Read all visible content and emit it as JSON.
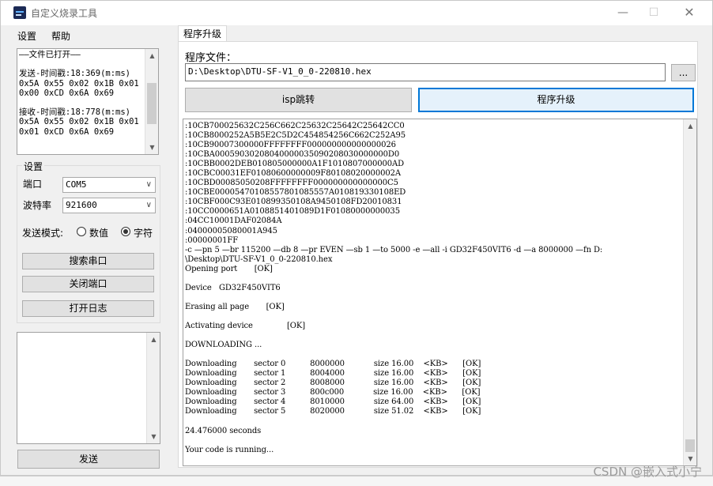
{
  "window": {
    "title": "自定义烧录工具",
    "controls": {
      "minimize": "—",
      "maximize": "☐",
      "close": "✕"
    }
  },
  "menu": {
    "items": [
      "设置",
      "帮助"
    ]
  },
  "log": {
    "lines": [
      "——文件已打开——",
      "",
      "发送-时间戳:18:369(m:ms)",
      "0x5A 0x55 0x02 0x1B 0x01",
      "0x00 0xCD 0x6A 0x69",
      "",
      "接收-时间戳:18:778(m:ms)",
      "0x5A 0x55 0x02 0x1B 0x01",
      "0x01 0xCD 0x6A 0x69"
    ],
    "scroll_position": 0.55
  },
  "settings": {
    "legend": "设置",
    "port_label": "端口",
    "port_value": "COM5",
    "baud_label": "波特率",
    "baud_value": "921600",
    "mode_label": "发送模式:",
    "mode_options": [
      "数值",
      "字符"
    ],
    "mode_selected": "字符",
    "btn_search": "搜索串口",
    "btn_close_port": "关闭端口",
    "btn_open_log": "打开日志"
  },
  "send_button": "发送",
  "tab": {
    "label": "程序升级"
  },
  "program": {
    "file_label": "程序文件：",
    "file_path": "D:\\Desktop\\DTU-SF-V1_0_0-220810.hex",
    "browse_label": "...",
    "isp_button": "isp跳转",
    "upgrade_button": "程序升级"
  },
  "console": {
    "lines": [
      ":10CB700025632C256C662C25632C25642C25642CC0",
      ":10CB8000252A5B5E2C5D2C454854256C662C252A95",
      ":10CB90007300000FFFFFFFF000000000000000026",
      ":10CBA00059030208040000035090208030000000D0",
      ":10CBB0002DEB010805000000A1F1010807000000AD",
      ":10CBC00031EF01080600000009F80108020000002A",
      ":10CBD00085050208FFFFFFFF000000000000000C5",
      ":10CBE00005470108557801085557A010819330108ED",
      ":10CBF000C93E010899350108A9450108FD20010831",
      ":10CC0000651A0108851401089D1F01080000000035",
      ":04CC10001DAF02084A",
      ":04000005080001A945",
      ":00000001FF",
      "-c —pn 5 —br 115200 —db 8 —pr EVEN —sb 1 —to 5000 -e —all -i GD32F450VIT6 -d —a 8000000 —fn D:",
      "\\Desktop\\DTU-SF-V1_0_0-220810.hex",
      "Opening port       [OK]",
      "",
      "Device   GD32F450VIT6",
      "",
      "Erasing all page       [OK]",
      "",
      "Activating device              [OK]",
      "",
      "DOWNLOADING ...",
      "",
      "Downloading       sector 0          8000000            size 16.00    <KB>      [OK]",
      "Downloading       sector 1          8004000            size 16.00    <KB>      [OK]",
      "Downloading       sector 2          8008000            size 16.00    <KB>      [OK]",
      "Downloading       sector 3          800c000            size 16.00    <KB>      [OK]",
      "Downloading       sector 4          8010000            size 64.00    <KB>      [OK]",
      "Downloading       sector 5          8020000            size 51.02    <KB>      [OK]",
      "",
      "24.476000 seconds",
      "",
      "Your code is running..."
    ],
    "scroll_position": 1.0
  },
  "watermark": "CSDN @嵌入式小宁",
  "colors": {
    "accent": "#0078d7",
    "panel": "#f0f0f0"
  }
}
